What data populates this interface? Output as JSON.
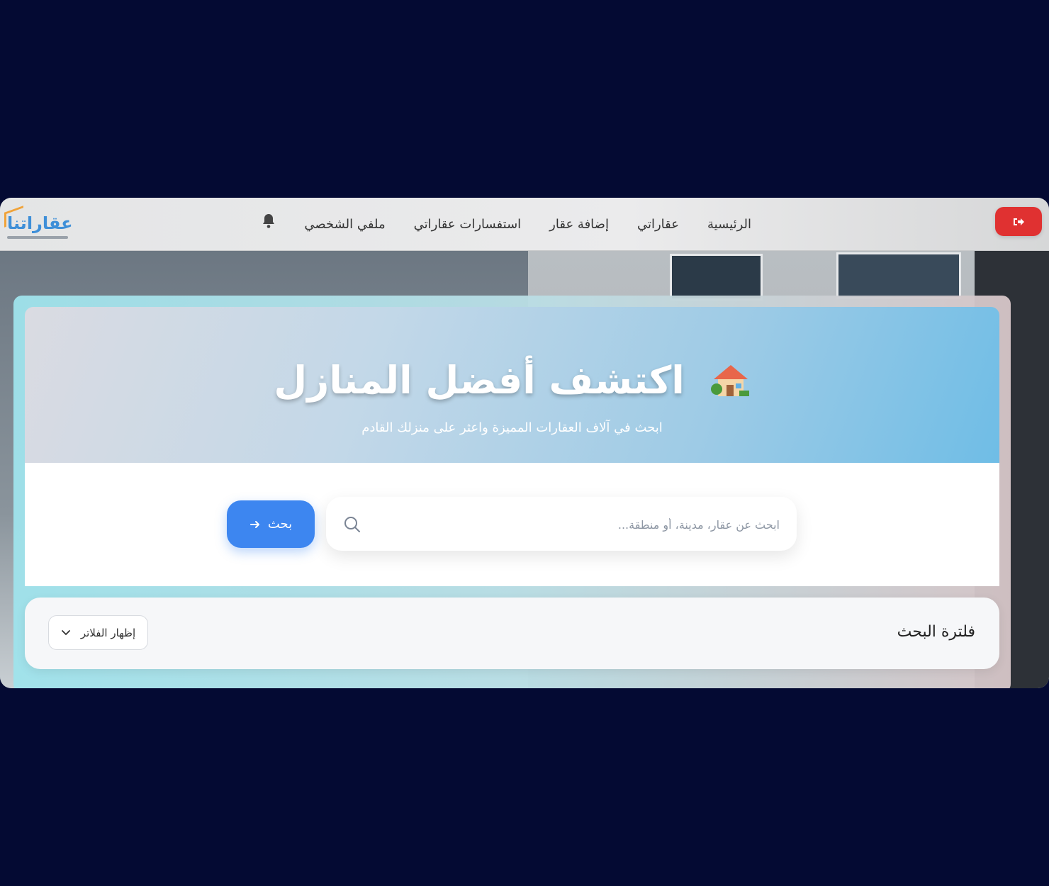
{
  "navbar": {
    "logo_text": "عقاراتنا",
    "links": [
      "الرئيسية",
      "عقاراتي",
      "إضافة عقار",
      "استفسارات عقاراتي",
      "ملفي الشخصي"
    ],
    "icons": {
      "logout": "logout-icon",
      "notifications": "bell-icon"
    },
    "logout_color": "#e03131"
  },
  "hero": {
    "title": "اكتشف أفضل المنازل",
    "subtitle": "ابحث في آلاف العقارات المميزة واعثر على منزلك القادم"
  },
  "search": {
    "placeholder": "ابحث عن عقار، مدينة، أو منطقة...",
    "button_label": "بحث",
    "button_color": "#3d86f0"
  },
  "filters": {
    "title": "فلترة البحث",
    "toggle_label": "إظهار الفلاتر"
  }
}
